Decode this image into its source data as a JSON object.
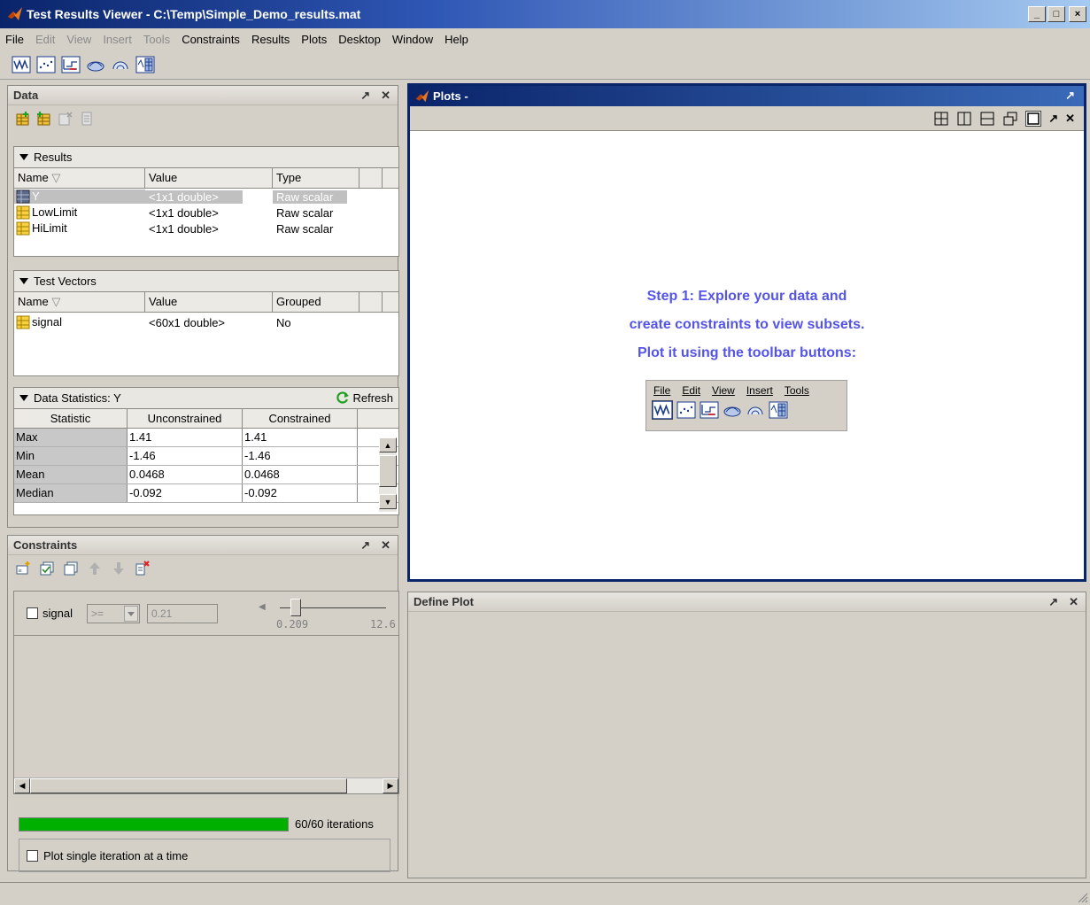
{
  "window": {
    "title": "Test Results Viewer - C:\\Temp\\Simple_Demo_results.mat",
    "minimize": "_",
    "maximize": "□",
    "close": "×"
  },
  "menu": [
    {
      "label": "File",
      "enabled": true
    },
    {
      "label": "Edit",
      "enabled": false
    },
    {
      "label": "View",
      "enabled": false
    },
    {
      "label": "Insert",
      "enabled": false
    },
    {
      "label": "Tools",
      "enabled": false
    },
    {
      "label": "Constraints",
      "enabled": true
    },
    {
      "label": "Results",
      "enabled": true
    },
    {
      "label": "Plots",
      "enabled": true
    },
    {
      "label": "Desktop",
      "enabled": true
    },
    {
      "label": "Window",
      "enabled": true
    },
    {
      "label": "Help",
      "enabled": true
    }
  ],
  "toolbar": {
    "icons": [
      "line-plot-icon",
      "scatter-plot-icon",
      "step-plot-icon",
      "surface-plot-icon",
      "polar-plot-icon",
      "table-plot-icon"
    ]
  },
  "data_panel": {
    "title": "Data",
    "undock": "↗",
    "close": "✕",
    "results": {
      "title": "Results",
      "columns": [
        "Name",
        "Value",
        "Type"
      ],
      "rows": [
        {
          "name": "Y",
          "value": "<1x1 double>",
          "type": "Raw scalar"
        },
        {
          "name": "LowLimit",
          "value": "<1x1 double>",
          "type": "Raw scalar"
        },
        {
          "name": "HiLimit",
          "value": "<1x1 double>",
          "type": "Raw scalar"
        }
      ]
    },
    "test_vectors": {
      "title": "Test Vectors",
      "columns": [
        "Name",
        "Value",
        "Grouped"
      ],
      "rows": [
        {
          "name": "signal",
          "value": "<60x1 double>",
          "grouped": "No"
        }
      ]
    },
    "statistics": {
      "title": "Data Statistics: Y",
      "refresh": "Refresh",
      "columns": [
        "Statistic",
        "Unconstrained",
        "Constrained"
      ],
      "rows": [
        {
          "stat": "Max",
          "unc": "1.41",
          "con": "1.41"
        },
        {
          "stat": "Min",
          "unc": "-1.46",
          "con": "-1.46"
        },
        {
          "stat": "Mean",
          "unc": "0.0468",
          "con": "0.0468"
        },
        {
          "stat": "Median",
          "unc": "-0.092",
          "con": "-0.092"
        }
      ]
    }
  },
  "constraints_panel": {
    "title": "Constraints",
    "undock": "↗",
    "close": "✕",
    "constraint": {
      "label": "signal",
      "operator": ">=",
      "value": "0.21",
      "slider_min": "0.209",
      "slider_max": "12.6",
      "slider_fraction": 0.0
    },
    "progress": {
      "fraction": 1.0,
      "text": "60/60 iterations"
    },
    "single_iteration": "Plot single iteration at a time"
  },
  "plots_window": {
    "title": "Plots -",
    "undock": "↗",
    "close": "✕",
    "step_lines": [
      "Step 1:  Explore your data and",
      "create constraints to view subsets.",
      "Plot it using the toolbar buttons:"
    ],
    "mini_menu": [
      "File",
      "Edit",
      "View",
      "Insert",
      "Tools"
    ]
  },
  "define_plot": {
    "title": "Define Plot",
    "undock": "↗",
    "close": "✕"
  },
  "colors": {
    "title_dark": "#0a246a",
    "step_text": "#5454e8",
    "progress": "#00b000"
  }
}
